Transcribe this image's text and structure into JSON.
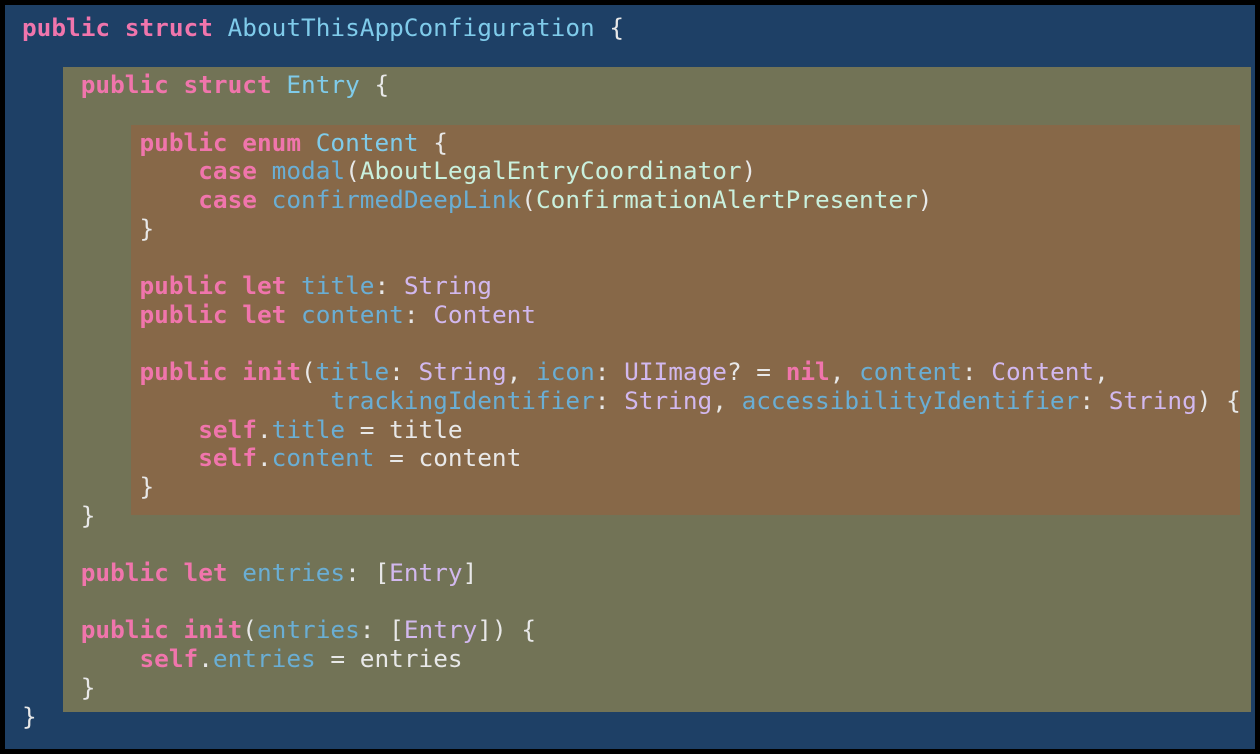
{
  "colors": {
    "outer_border": "#000000",
    "background": "#1e4066",
    "entry_highlight": "#727356",
    "content_highlight": "#876848",
    "keyword": "#f075ac",
    "type_declaration": "#7fcbea",
    "property": "#6aaed4",
    "type_reference": "#d2b8ee",
    "class_reference": "#c9f0dd",
    "plain": "#e8e8e8"
  },
  "code": {
    "lines": [
      [
        {
          "t": "public",
          "c": "kw"
        },
        {
          "t": " ",
          "c": "pl"
        },
        {
          "t": "struct",
          "c": "kw"
        },
        {
          "t": " ",
          "c": "pl"
        },
        {
          "t": "AboutThisAppConfiguration",
          "c": "typ"
        },
        {
          "t": " {",
          "c": "pl"
        }
      ],
      [],
      [
        {
          "t": "    ",
          "c": "pl"
        },
        {
          "t": "public",
          "c": "kw"
        },
        {
          "t": " ",
          "c": "pl"
        },
        {
          "t": "struct",
          "c": "kw"
        },
        {
          "t": " ",
          "c": "pl"
        },
        {
          "t": "Entry",
          "c": "typ"
        },
        {
          "t": " {",
          "c": "pl"
        }
      ],
      [],
      [
        {
          "t": "        ",
          "c": "pl"
        },
        {
          "t": "public",
          "c": "kw"
        },
        {
          "t": " ",
          "c": "pl"
        },
        {
          "t": "enum",
          "c": "kw"
        },
        {
          "t": " ",
          "c": "pl"
        },
        {
          "t": "Content",
          "c": "typ"
        },
        {
          "t": " {",
          "c": "pl"
        }
      ],
      [
        {
          "t": "            ",
          "c": "pl"
        },
        {
          "t": "case",
          "c": "kw"
        },
        {
          "t": " ",
          "c": "pl"
        },
        {
          "t": "modal",
          "c": "prm"
        },
        {
          "t": "(",
          "c": "pl"
        },
        {
          "t": "AboutLegalEntryCoordinator",
          "c": "cls"
        },
        {
          "t": ")",
          "c": "pl"
        }
      ],
      [
        {
          "t": "            ",
          "c": "pl"
        },
        {
          "t": "case",
          "c": "kw"
        },
        {
          "t": " ",
          "c": "pl"
        },
        {
          "t": "confirmedDeepLink",
          "c": "prm"
        },
        {
          "t": "(",
          "c": "pl"
        },
        {
          "t": "ConfirmationAlertPresenter",
          "c": "cls"
        },
        {
          "t": ")",
          "c": "pl"
        }
      ],
      [
        {
          "t": "        }",
          "c": "pl"
        }
      ],
      [],
      [
        {
          "t": "        ",
          "c": "pl"
        },
        {
          "t": "public",
          "c": "kw"
        },
        {
          "t": " ",
          "c": "pl"
        },
        {
          "t": "let",
          "c": "kw"
        },
        {
          "t": " ",
          "c": "pl"
        },
        {
          "t": "title",
          "c": "prm"
        },
        {
          "t": ": ",
          "c": "pl"
        },
        {
          "t": "String",
          "c": "ty2"
        }
      ],
      [
        {
          "t": "        ",
          "c": "pl"
        },
        {
          "t": "public",
          "c": "kw"
        },
        {
          "t": " ",
          "c": "pl"
        },
        {
          "t": "let",
          "c": "kw"
        },
        {
          "t": " ",
          "c": "pl"
        },
        {
          "t": "content",
          "c": "prm"
        },
        {
          "t": ": ",
          "c": "pl"
        },
        {
          "t": "Content",
          "c": "ty2"
        }
      ],
      [],
      [
        {
          "t": "        ",
          "c": "pl"
        },
        {
          "t": "public",
          "c": "kw"
        },
        {
          "t": " ",
          "c": "pl"
        },
        {
          "t": "init",
          "c": "kw"
        },
        {
          "t": "(",
          "c": "pl"
        },
        {
          "t": "title",
          "c": "prm"
        },
        {
          "t": ": ",
          "c": "pl"
        },
        {
          "t": "String",
          "c": "ty2"
        },
        {
          "t": ", ",
          "c": "pl"
        },
        {
          "t": "icon",
          "c": "prm"
        },
        {
          "t": ": ",
          "c": "pl"
        },
        {
          "t": "UIImage",
          "c": "ty2"
        },
        {
          "t": "? = ",
          "c": "pl"
        },
        {
          "t": "nil",
          "c": "kw"
        },
        {
          "t": ", ",
          "c": "pl"
        },
        {
          "t": "content",
          "c": "prm"
        },
        {
          "t": ": ",
          "c": "pl"
        },
        {
          "t": "Content",
          "c": "ty2"
        },
        {
          "t": ",",
          "c": "pl"
        }
      ],
      [
        {
          "t": "                     ",
          "c": "pl"
        },
        {
          "t": "trackingIdentifier",
          "c": "prm"
        },
        {
          "t": ": ",
          "c": "pl"
        },
        {
          "t": "String",
          "c": "ty2"
        },
        {
          "t": ", ",
          "c": "pl"
        },
        {
          "t": "accessibilityIdentifier",
          "c": "prm"
        },
        {
          "t": ": ",
          "c": "pl"
        },
        {
          "t": "String",
          "c": "ty2"
        },
        {
          "t": ") {",
          "c": "pl"
        }
      ],
      [
        {
          "t": "            ",
          "c": "pl"
        },
        {
          "t": "self",
          "c": "kw"
        },
        {
          "t": ".",
          "c": "pl"
        },
        {
          "t": "title",
          "c": "prm"
        },
        {
          "t": " = title",
          "c": "pl"
        }
      ],
      [
        {
          "t": "            ",
          "c": "pl"
        },
        {
          "t": "self",
          "c": "kw"
        },
        {
          "t": ".",
          "c": "pl"
        },
        {
          "t": "content",
          "c": "prm"
        },
        {
          "t": " = content",
          "c": "pl"
        }
      ],
      [
        {
          "t": "        }",
          "c": "pl"
        }
      ],
      [
        {
          "t": "    }",
          "c": "pl"
        }
      ],
      [],
      [
        {
          "t": "    ",
          "c": "pl"
        },
        {
          "t": "public",
          "c": "kw"
        },
        {
          "t": " ",
          "c": "pl"
        },
        {
          "t": "let",
          "c": "kw"
        },
        {
          "t": " ",
          "c": "pl"
        },
        {
          "t": "entries",
          "c": "prm"
        },
        {
          "t": ": [",
          "c": "pl"
        },
        {
          "t": "Entry",
          "c": "ty2"
        },
        {
          "t": "]",
          "c": "pl"
        }
      ],
      [],
      [
        {
          "t": "    ",
          "c": "pl"
        },
        {
          "t": "public",
          "c": "kw"
        },
        {
          "t": " ",
          "c": "pl"
        },
        {
          "t": "init",
          "c": "kw"
        },
        {
          "t": "(",
          "c": "pl"
        },
        {
          "t": "entries",
          "c": "prm"
        },
        {
          "t": ": [",
          "c": "pl"
        },
        {
          "t": "Entry",
          "c": "ty2"
        },
        {
          "t": "]) {",
          "c": "pl"
        }
      ],
      [
        {
          "t": "        ",
          "c": "pl"
        },
        {
          "t": "self",
          "c": "kw"
        },
        {
          "t": ".",
          "c": "pl"
        },
        {
          "t": "entries",
          "c": "prm"
        },
        {
          "t": " = entries",
          "c": "pl"
        }
      ],
      [
        {
          "t": "    }",
          "c": "pl"
        }
      ],
      [
        {
          "t": "}",
          "c": "pl"
        }
      ]
    ]
  }
}
